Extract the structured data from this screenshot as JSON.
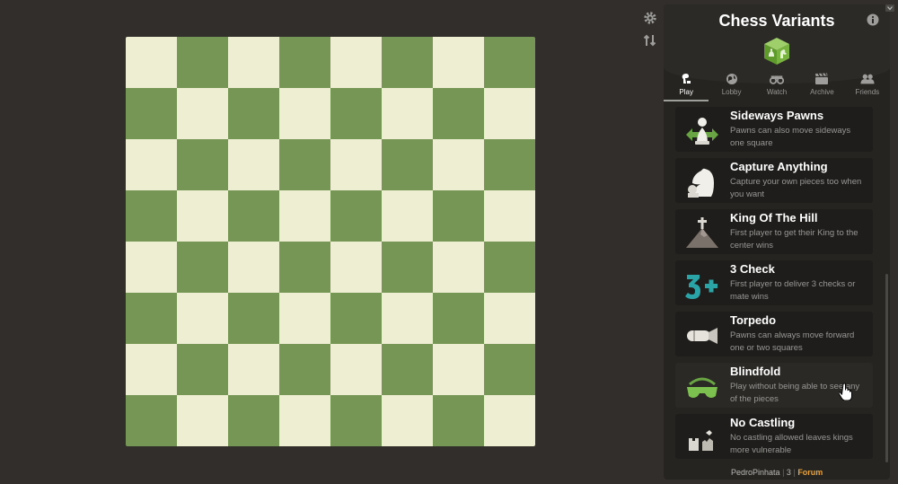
{
  "title": "Chess Variants",
  "tabs": [
    {
      "label": "Play",
      "icon": "pawn-play-icon",
      "active": true
    },
    {
      "label": "Lobby",
      "icon": "globe-icon",
      "active": false
    },
    {
      "label": "Watch",
      "icon": "binoculars-icon",
      "active": false
    },
    {
      "label": "Archive",
      "icon": "film-archive-icon",
      "active": false
    },
    {
      "label": "Friends",
      "icon": "friends-icon",
      "active": false
    }
  ],
  "variants": [
    {
      "name": "Sideways Pawns",
      "desc": "Pawns can also move sideways one square",
      "icon": "sideways-pawn-icon"
    },
    {
      "name": "Capture Anything",
      "desc": "Capture your own pieces too when you want",
      "icon": "knight-capture-icon"
    },
    {
      "name": "King Of The Hill",
      "desc": "First player to get their King to the center wins",
      "icon": "hill-king-icon"
    },
    {
      "name": "3 Check",
      "desc": "First player to deliver 3 checks or mate wins",
      "icon": "three-check-icon"
    },
    {
      "name": "Torpedo",
      "desc": "Pawns can always move forward one or two squares",
      "icon": "torpedo-icon"
    },
    {
      "name": "Blindfold",
      "desc": "Play without being able to see any of the pieces",
      "icon": "blindfold-icon"
    },
    {
      "name": "No Castling",
      "desc": "No castling allowed leaves kings more vulnerable",
      "icon": "broken-castle-icon"
    }
  ],
  "footer": {
    "user": "PedroPinhata",
    "sep1": "|",
    "count": "3",
    "sep2": "|",
    "forum": "Forum"
  },
  "colors": {
    "light_square": "#eeeed2",
    "dark_square": "#769656",
    "accent": "#e8a33b"
  }
}
